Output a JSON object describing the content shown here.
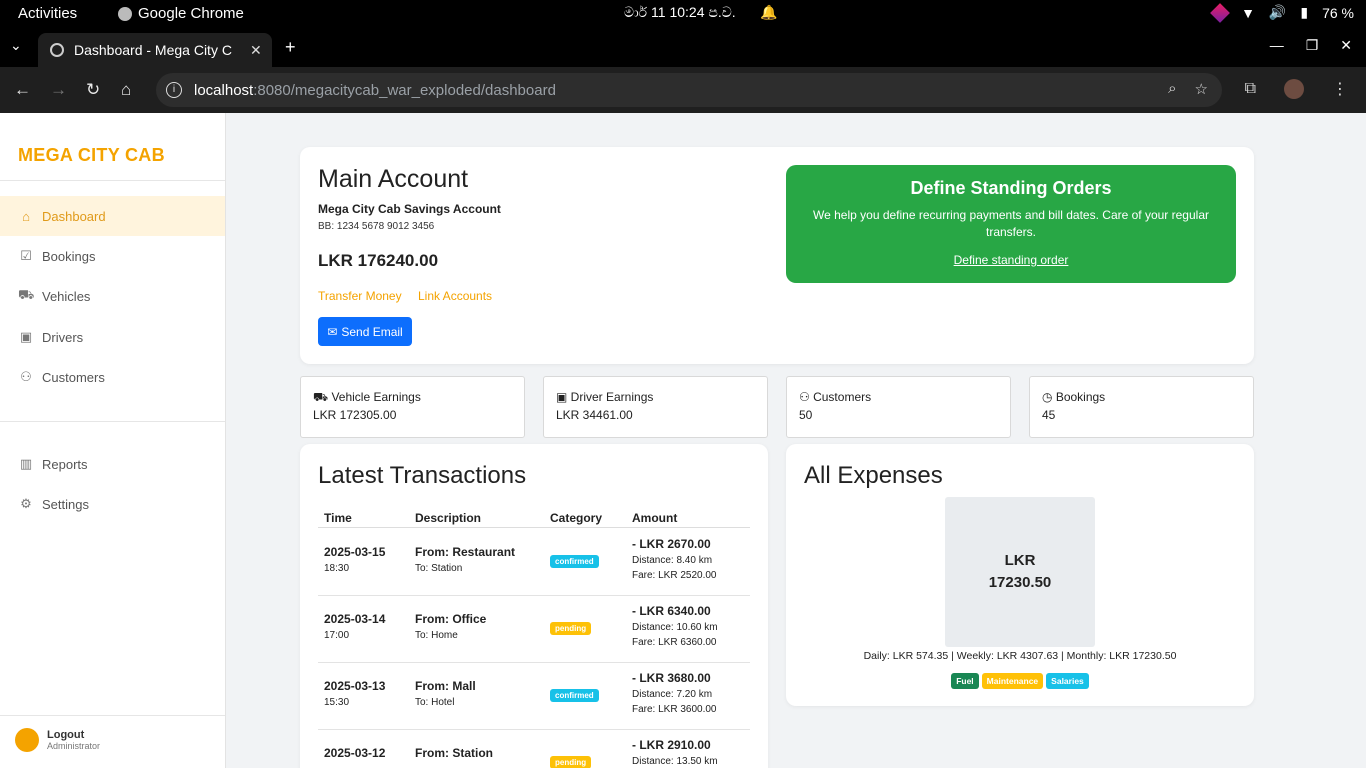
{
  "os": {
    "activities": "Activities",
    "app_name": "Google Chrome",
    "clock": "මාර් 11  10:24 ප.ව.",
    "battery": "76 %"
  },
  "browser": {
    "tab_title": "Dashboard - Mega City C",
    "url_host": "localhost",
    "url_path": ":8080/megacitycab_war_exploded/dashboard"
  },
  "sidebar": {
    "brand": "MEGA CITY CAB",
    "items": [
      {
        "label": "Dashboard",
        "icon": "home-icon"
      },
      {
        "label": "Bookings",
        "icon": "calendar-check-icon"
      },
      {
        "label": "Vehicles",
        "icon": "car-icon"
      },
      {
        "label": "Drivers",
        "icon": "id-badge-icon"
      },
      {
        "label": "Customers",
        "icon": "people-icon"
      }
    ],
    "secondary": [
      {
        "label": "Reports",
        "icon": "bar-chart-icon"
      },
      {
        "label": "Settings",
        "icon": "gear-icon"
      }
    ],
    "user": {
      "name": "Logout",
      "role": "Administrator"
    }
  },
  "main_account": {
    "title": "Main Account",
    "account_name": "Mega City Cab Savings Account",
    "account_number": "BB: 1234 5678 9012 3456",
    "balance": "LKR 176240.00",
    "link_transfer": "Transfer Money",
    "link_accounts": "Link Accounts",
    "email_button": "Send Email"
  },
  "standing_orders": {
    "title": "Define Standing Orders",
    "description": "We help you define recurring payments and bill dates. Care of your regular transfers.",
    "link": "Define standing order"
  },
  "stats": [
    {
      "label": "Vehicle Earnings",
      "value": "LKR 172305.00",
      "icon": "car-icon"
    },
    {
      "label": "Driver Earnings",
      "value": "LKR 34461.00",
      "icon": "id-badge-icon"
    },
    {
      "label": "Customers",
      "value": "50",
      "icon": "people-icon"
    },
    {
      "label": "Bookings",
      "value": "45",
      "icon": "clock-icon"
    }
  ],
  "transactions": {
    "title": "Latest Transactions",
    "headers": [
      "Time",
      "Description",
      "Category",
      "Amount"
    ],
    "rows": [
      {
        "date": "2025-03-15",
        "time": "18:30",
        "from": "From: Restaurant",
        "to": "To: Station",
        "status": "confirmed",
        "amount": "- LKR 2670.00",
        "distance": "Distance: 8.40 km",
        "fare": "Fare: LKR 2520.00"
      },
      {
        "date": "2025-03-14",
        "time": "17:00",
        "from": "From: Office",
        "to": "To: Home",
        "status": "pending",
        "amount": "- LKR 6340.00",
        "distance": "Distance: 10.60 km",
        "fare": "Fare: LKR 6360.00"
      },
      {
        "date": "2025-03-13",
        "time": "15:30",
        "from": "From: Mall",
        "to": "To: Hotel",
        "status": "confirmed",
        "amount": "- LKR 3680.00",
        "distance": "Distance: 7.20 km",
        "fare": "Fare: LKR 3600.00"
      },
      {
        "date": "2025-03-12",
        "time": "",
        "from": "From: Station",
        "to": "",
        "status": "pending",
        "amount": "- LKR 2910.00",
        "distance": "Distance: 13.50 km",
        "fare": ""
      }
    ]
  },
  "expenses": {
    "title": "All Expenses",
    "total_line1": "LKR",
    "total_line2": "17230.50",
    "summary": "Daily: LKR 574.35 | Weekly: LKR 4307.63 | Monthly: LKR 17230.50",
    "tags": [
      {
        "label": "Fuel",
        "color": "#198754"
      },
      {
        "label": "Maintenance",
        "color": "#ffc107"
      },
      {
        "label": "Salaries",
        "color": "#17c1e8"
      }
    ]
  }
}
